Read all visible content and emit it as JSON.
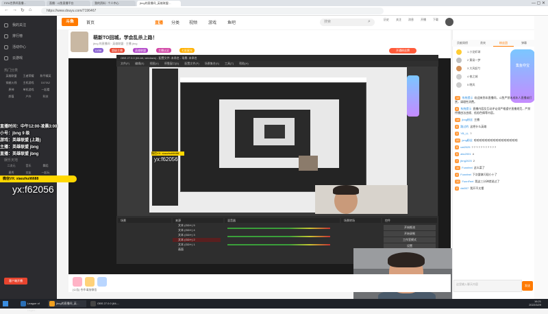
{
  "browser": {
    "tabs": [
      {
        "label": "FIFA世界杯直播…"
      },
      {
        "label": "直播 · 斗鱼直播平台"
      },
      {
        "label": "我的资料 · 个人中心"
      },
      {
        "label": "jbng的直播间_英雄联盟…",
        "active": true
      }
    ],
    "url": "https://www.douyu.com/7196467",
    "window_controls": "—  ▢  ✕"
  },
  "header": {
    "logo": "斗鱼",
    "nav": [
      "首页",
      "直播",
      "分类",
      "视频",
      "游戏",
      "鱼吧"
    ],
    "active_nav": "直播",
    "search_placeholder": "搜索",
    "icons": [
      "历史",
      "关注",
      "消息",
      "开播",
      "下载"
    ]
  },
  "sidebar": {
    "items": [
      "我的关注",
      "排行榜",
      "活动中心",
      "云游戏"
    ],
    "section_title": "热门分类",
    "grid": [
      "英雄联盟",
      "王者荣耀",
      "和平精英",
      "穿越火线",
      "主机游戏",
      "DOTA2",
      "原神",
      "单机游戏",
      "一起看",
      "颜值",
      "户外",
      "科技"
    ],
    "section2_title": "娱乐天地",
    "grid2": [
      "二次元",
      "音乐",
      "舞蹈",
      "星秀",
      "交友",
      "一起玩"
    ],
    "cta": "客户端开播"
  },
  "room": {
    "title": "萌新TO回城，学会乱杀上路！",
    "subtitle": "jbng 的直播间 · 英雄联盟 · 主播 jbng",
    "tags": [
      {
        "label": "LV88",
        "color": "#8a63d2"
      },
      {
        "label": "超级主播",
        "color": "#e8452f"
      },
      {
        "label": "英雄联盟",
        "color": "#b145c8"
      },
      {
        "label": "主播认证",
        "color": "#d246a5"
      },
      {
        "label": "七彩星光",
        "color": "#ffb100"
      }
    ],
    "fan_button": "开通粉丝牌"
  },
  "obs": {
    "title": "OBS 27.0.0 (64-bit, windows) - 配置文件: 未命名 - 场景: 未命名",
    "menu": [
      "文件(F)",
      "编辑(E)",
      "视图(V)",
      "停靠窗口(D)",
      "配置文件(P)",
      "场景集合(S)",
      "工具(T)",
      "帮助(H)"
    ],
    "docks": [
      "场景",
      "来源",
      "混音器",
      "场景转场",
      "控件"
    ],
    "sources": [
      "文本 (GDI+) 5",
      "文本 (GDI+) 4",
      "文本 (GDI+) 3",
      "文本 (GDI+) 2",
      "文本 (GDI+) 1",
      "画面"
    ],
    "controls": [
      "开始推流",
      "开始录制",
      "工作室模式",
      "设置",
      "退出"
    ]
  },
  "overlay": {
    "lines": [
      "直播时间：中午12:00-凌晨3:00",
      "小号：jbng 9 级",
      "游戏：英雄联盟 (上路)",
      "主播：英雄联盟 jbng",
      "直播：英雄联盟 jbng"
    ],
    "banner": "微信VX: xiaozhuli6688",
    "big_vx": "yx:f62056",
    "small_vx": "yx:f62056",
    "small_banner": "微信VX: xiaozhuli6688"
  },
  "chat": {
    "tabs": [
      "贡献周榜",
      "贵宾",
      "粉丝团",
      "弹幕"
    ],
    "active_tab": "粉丝团",
    "rank": [
      "1 小龙虾球",
      "2 黄粱一梦",
      "3 大风起兮",
      "4 夜之城",
      "5 晚风"
    ],
    "mascot_label": "集鱼夺宝",
    "messages": [
      {
        "lv": "12",
        "name": "系统提示",
        "text": "欢迎来到本直播间，斗鱼严禁未成年人直播或打赏，请理性消费。"
      },
      {
        "lv": "8",
        "name": "系统提示",
        "text": "直播内容及互动评论须严格遵守直播规范，严禁传播违法违规、低俗色情等内容。"
      },
      {
        "lv": "15",
        "name": "jbng粉丝",
        "text": "主播"
      },
      {
        "lv": "6",
        "name": "路过的",
        "text": "这把什么英雄"
      },
      {
        "lv": "3",
        "name": "YB_LL",
        "text": "?"
      },
      {
        "lv": "20",
        "name": "jcng粉丝",
        "text": "哈哈哈哈哈哈哈哈哈哈哈哈哈哈哈哈"
      },
      {
        "lv": "9",
        "name": "cat2025",
        "text": "? ? ? ? ? ? ? ? ? ? ?"
      },
      {
        "lv": "5",
        "name": "abc2001",
        "text": "4"
      },
      {
        "lv": "7",
        "name": "jbng2025",
        "text": "2"
      },
      {
        "lv": "11",
        "name": "Funnfeel",
        "text": "这么菜了"
      },
      {
        "lv": "4",
        "name": "Funnfeel",
        "text": "下次要拿闪现小十了"
      },
      {
        "lv": "10",
        "name": "FunnFeel",
        "text": "我这三分钟就说过了"
      },
      {
        "lv": "2",
        "name": "dst007",
        "text": "我开不太懂"
      }
    ],
    "input_placeholder": "这里输入聊天内容",
    "send": "发送"
  },
  "taskbar": {
    "apps": [
      {
        "label": "League of Legen...",
        "color": "#2a6fb5"
      },
      {
        "label": "jbng的直播间_英…",
        "color": "#f0a020"
      },
      {
        "label": "OBS 27.0.0 (64-...",
        "color": "#444"
      }
    ],
    "time": "16:21",
    "date": "2022/3/29"
  },
  "bottom_bar": {
    "notice": "[公告] 合作请加微信"
  }
}
